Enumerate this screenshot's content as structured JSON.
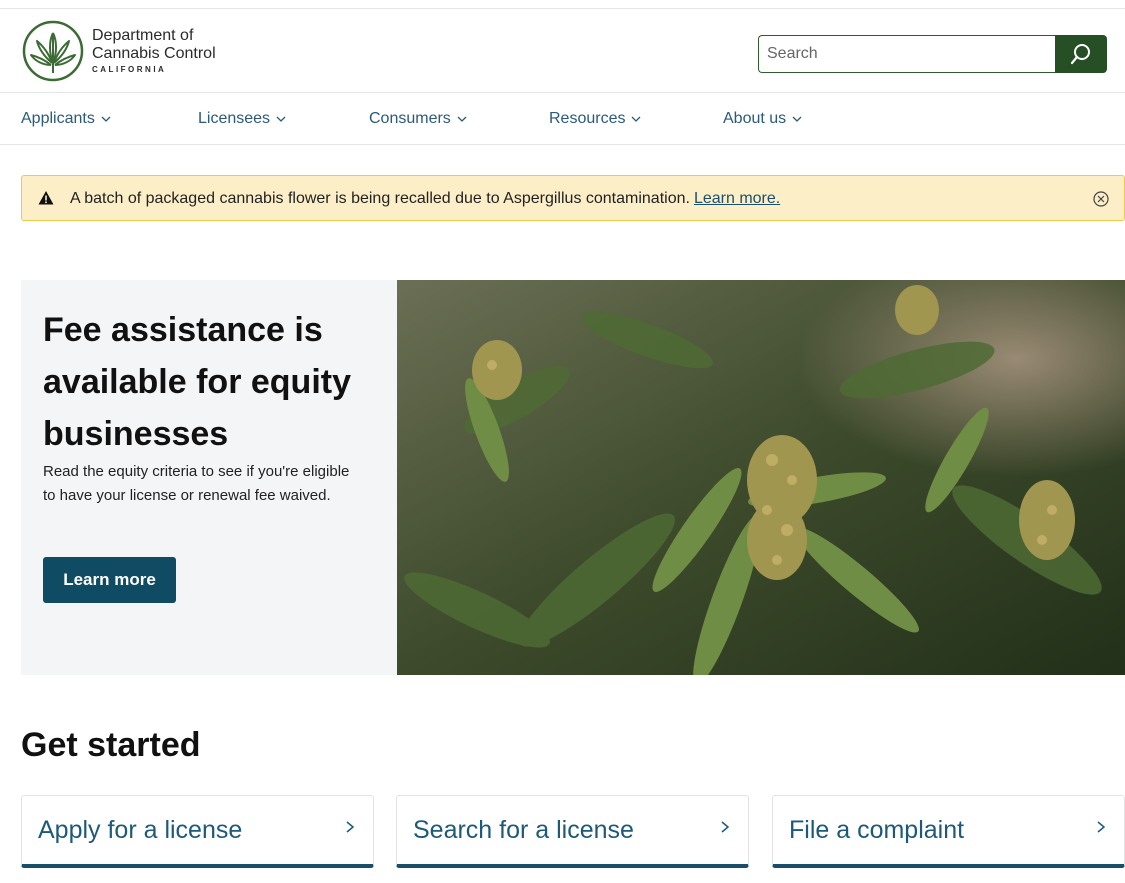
{
  "header": {
    "logo_line1": "Department of",
    "logo_line2": "Cannabis Control",
    "logo_line3": "CALIFORNIA",
    "search_placeholder": "Search"
  },
  "nav": {
    "items": [
      {
        "label": "Applicants"
      },
      {
        "label": "Licensees"
      },
      {
        "label": "Consumers"
      },
      {
        "label": "Resources"
      },
      {
        "label": "About us"
      }
    ]
  },
  "alert": {
    "message": "A batch of packaged cannabis flower is being recalled due to Aspergillus contamination.",
    "link_label": "Learn more."
  },
  "hero": {
    "title": "Fee assistance is available for equity businesses",
    "body": "Read the equity criteria to see if you're eligible to have your license or renewal fee waived.",
    "button_label": "Learn more"
  },
  "get_started": {
    "title": "Get started",
    "cards": [
      {
        "label": "Apply for a license"
      },
      {
        "label": "Search for a license"
      },
      {
        "label": "File a complaint"
      }
    ]
  },
  "colors": {
    "brand_green": "#264f26",
    "nav_link": "#2b5a7b",
    "alert_bg": "#fcefc8",
    "button_teal": "#0f4b63",
    "card_border": "#184e68"
  }
}
